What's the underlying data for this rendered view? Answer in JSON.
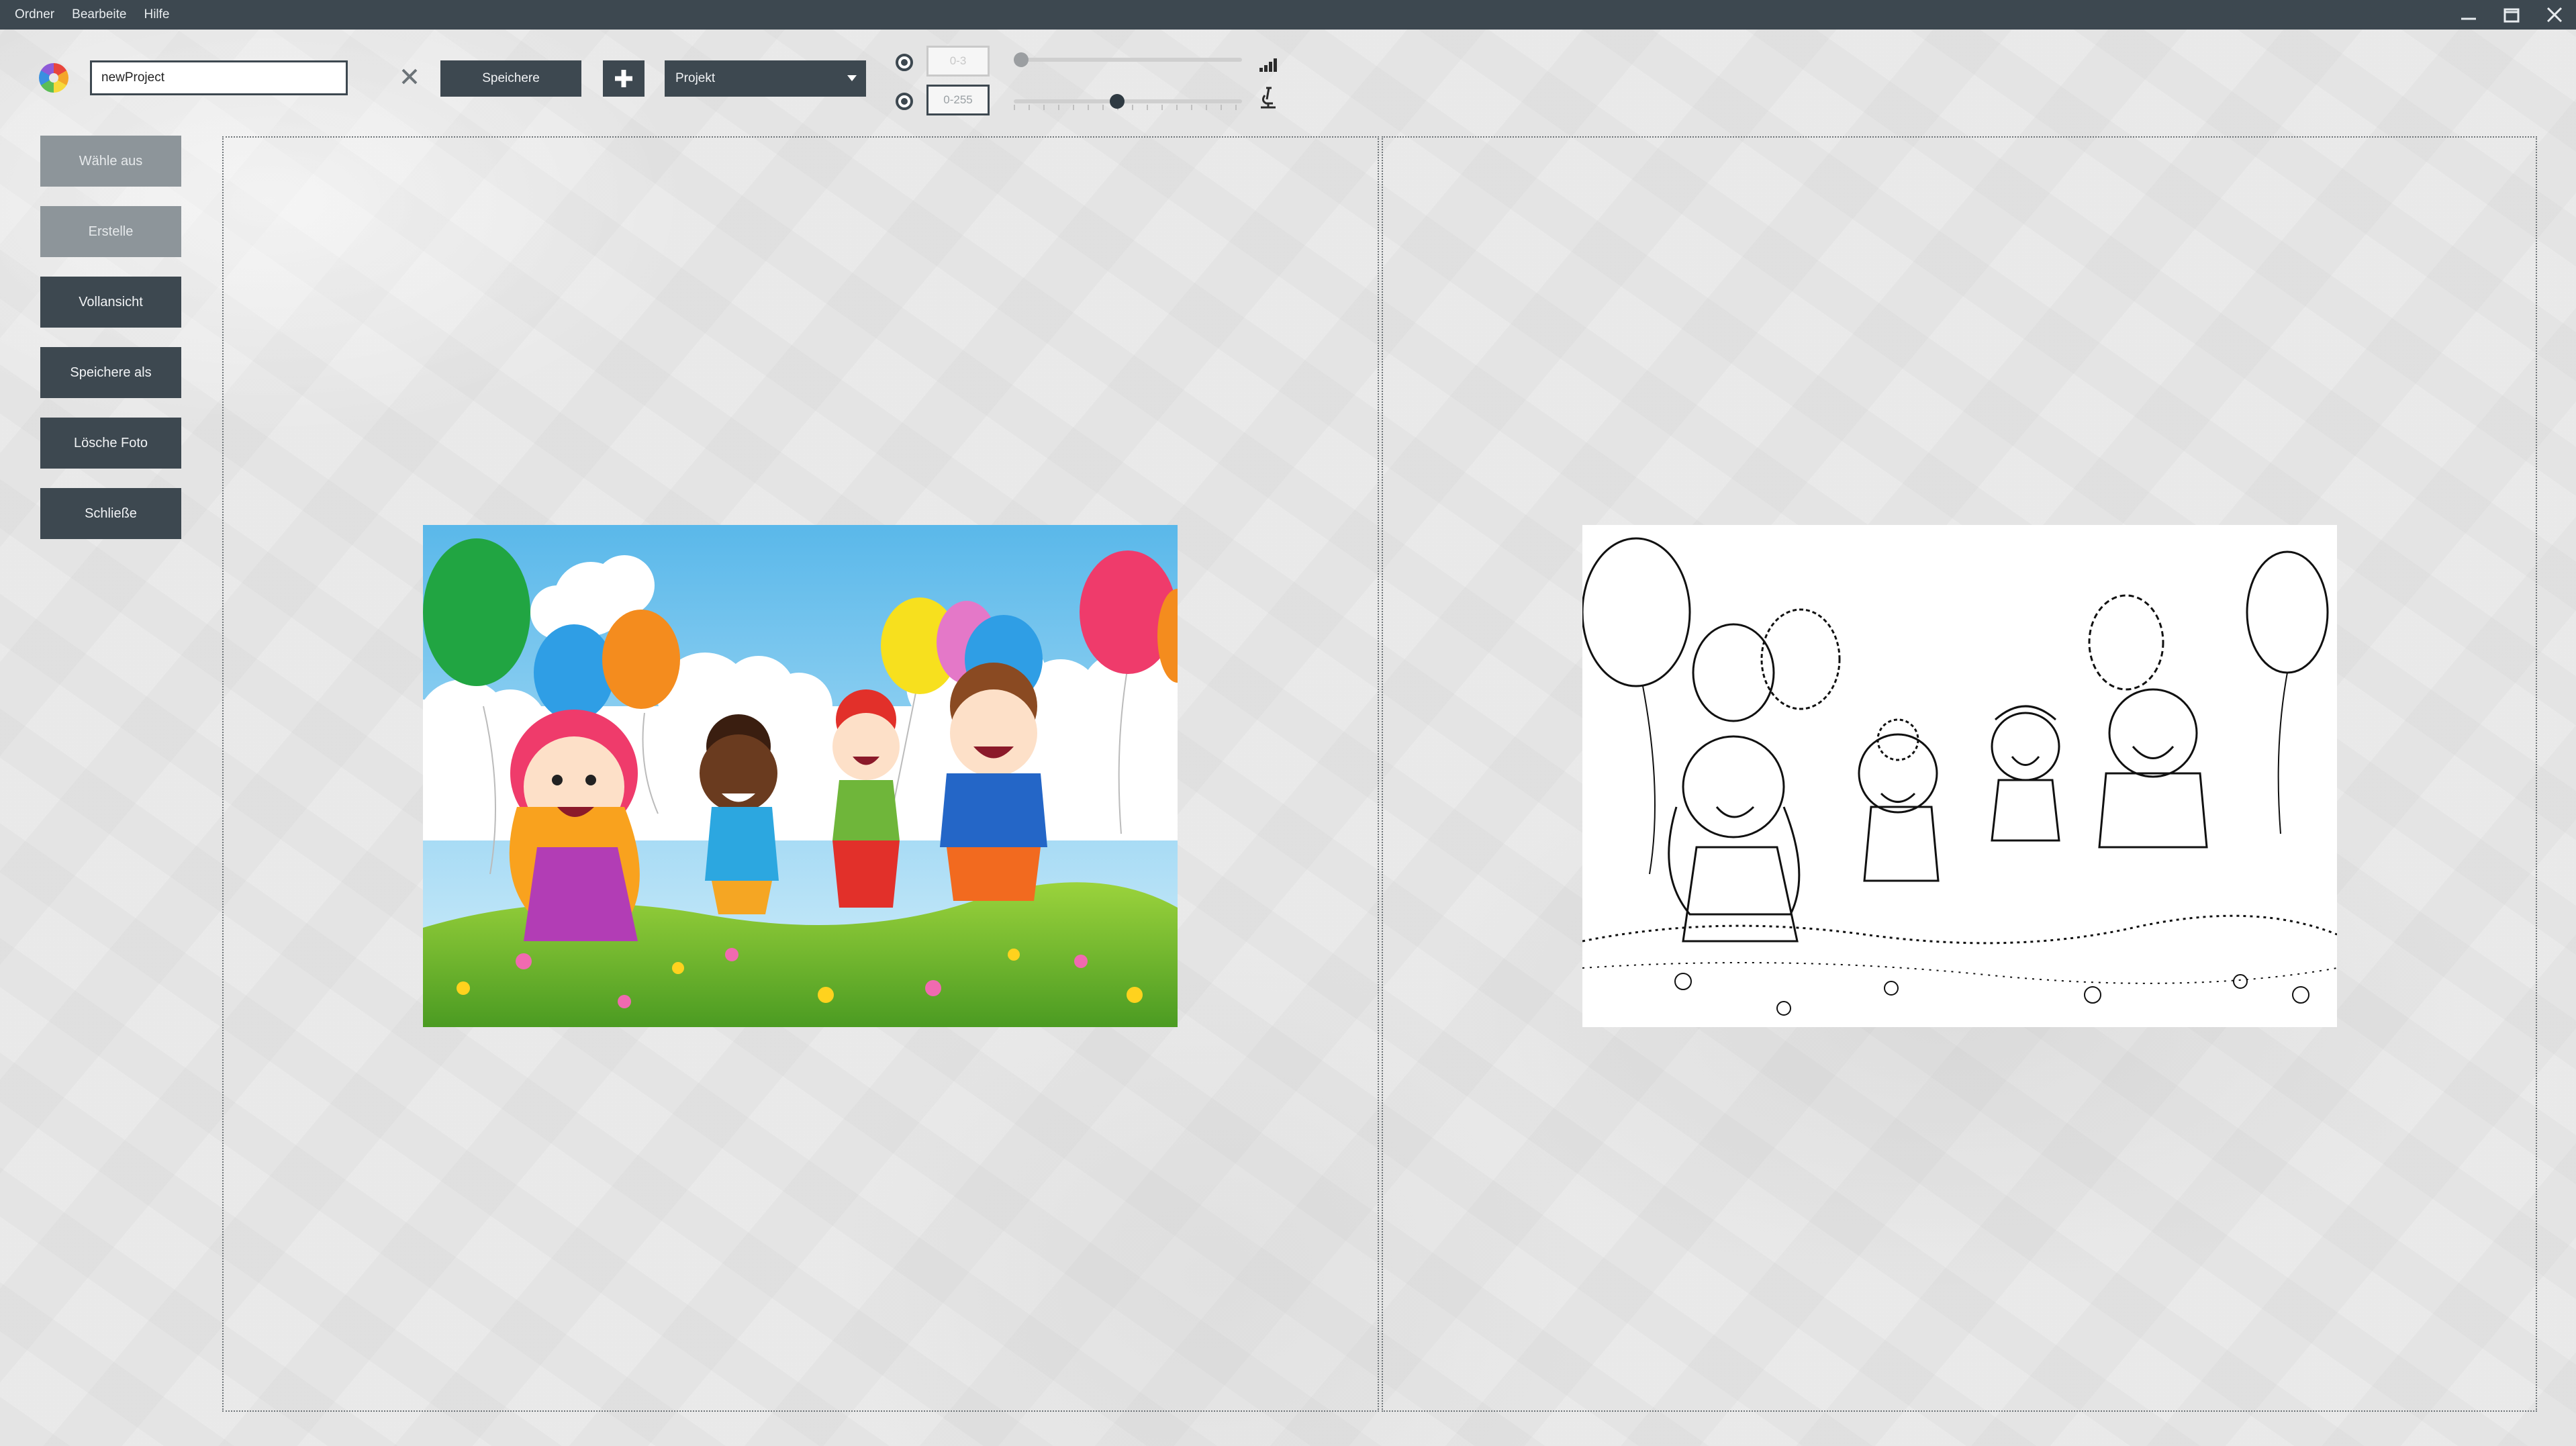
{
  "menubar": {
    "items": [
      "Ordner",
      "Bearbeite",
      "Hilfe"
    ]
  },
  "window_controls": {
    "minimize_icon": "minimize-icon",
    "maximize_icon": "maximize-icon",
    "close_icon": "close-icon"
  },
  "toolbar": {
    "logo_icon": "color-wheel-icon",
    "project_name_value": "newProject",
    "clear_icon": "clear-x-icon",
    "save_label": "Speichere",
    "add_icon": "plus-icon",
    "project_dropdown_selected": "Projekt",
    "range_threshold_placeholder": "0-3",
    "range_brightness_placeholder": "0-255",
    "slider_threshold_value": 0,
    "slider_brightness_value": 0.45,
    "signal_icon": "signal-strength-icon",
    "microscope_icon": "microscope-icon"
  },
  "sidebar": {
    "buttons": [
      {
        "label": "Wähle aus",
        "enabled": false
      },
      {
        "label": "Erstelle",
        "enabled": false
      },
      {
        "label": "Vollansicht",
        "enabled": true
      },
      {
        "label": "Speichere als",
        "enabled": true
      },
      {
        "label": "Lösche Foto",
        "enabled": true
      },
      {
        "label": "Schließe",
        "enabled": true
      }
    ]
  },
  "panels": {
    "left_image": "colored cartoon children with balloons",
    "right_image": "line-drawing sketch of children with balloons"
  },
  "colors": {
    "chrome_dark": "#3d4850",
    "disabled_button": "#8d959a"
  }
}
